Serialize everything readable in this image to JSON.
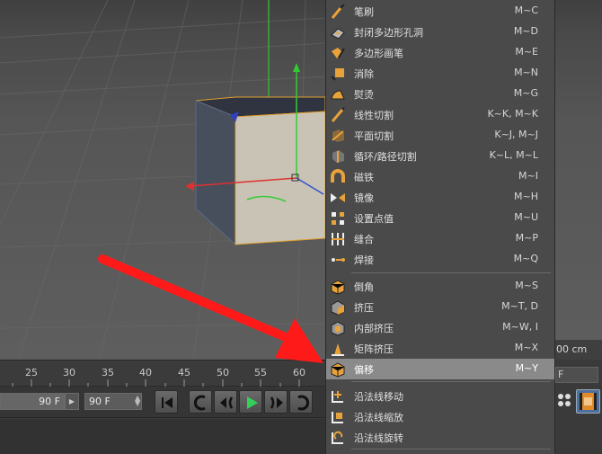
{
  "menu": {
    "items": [
      {
        "label": "笔刷",
        "shortcut": "M~C",
        "icon": "brush-icon"
      },
      {
        "label": "封闭多边形孔洞",
        "shortcut": "M~D",
        "icon": "close-hole-icon"
      },
      {
        "label": "多边形画笔",
        "shortcut": "M~E",
        "icon": "polygon-pen-icon"
      },
      {
        "label": "消除",
        "shortcut": "M~N",
        "icon": "dissolve-icon"
      },
      {
        "label": "熨烫",
        "shortcut": "M~G",
        "icon": "iron-icon"
      },
      {
        "label": "线性切割",
        "shortcut": "K~K, M~K",
        "icon": "line-cut-icon"
      },
      {
        "label": "平面切割",
        "shortcut": "K~J, M~J",
        "icon": "plane-cut-icon"
      },
      {
        "label": "循环/路径切割",
        "shortcut": "K~L, M~L",
        "icon": "loop-cut-icon"
      },
      {
        "label": "磁铁",
        "shortcut": "M~I",
        "icon": "magnet-icon"
      },
      {
        "label": "镜像",
        "shortcut": "M~H",
        "icon": "mirror-icon"
      },
      {
        "label": "设置点值",
        "shortcut": "M~U",
        "icon": "set-point-icon"
      },
      {
        "label": "缝合",
        "shortcut": "M~P",
        "icon": "stitch-icon"
      },
      {
        "label": "焊接",
        "shortcut": "M~Q",
        "icon": "weld-icon"
      },
      {
        "label": "倒角",
        "shortcut": "M~S",
        "icon": "bevel-icon"
      },
      {
        "label": "挤压",
        "shortcut": "M~T, D",
        "icon": "extrude-icon"
      },
      {
        "label": "内部挤压",
        "shortcut": "M~W, I",
        "icon": "extrude-inner-icon"
      },
      {
        "label": "矩阵挤压",
        "shortcut": "M~X",
        "icon": "matrix-extrude-icon"
      },
      {
        "label": "偏移",
        "shortcut": "M~Y",
        "icon": "offset-icon"
      },
      {
        "label": "沿法线移动",
        "shortcut": "",
        "icon": "normal-move-icon"
      },
      {
        "label": "沿法线缩放",
        "shortcut": "",
        "icon": "normal-scale-icon"
      },
      {
        "label": "沿法线旋转",
        "shortcut": "",
        "icon": "normal-rotate-icon"
      }
    ],
    "active_index": 17
  },
  "timeline": {
    "ticks": [
      "25",
      "30",
      "35",
      "40",
      "45",
      "50",
      "55",
      "60"
    ]
  },
  "transport": {
    "left_field": "90 F",
    "right_field": "90 F",
    "buttons": [
      "go-to-start-icon",
      "prev-key-icon",
      "prev-frame-icon",
      "play-icon",
      "next-frame-icon",
      "next-key-icon"
    ]
  },
  "viewport": {
    "units_readout": "00 cm"
  },
  "right_panel": {
    "field_text": "F"
  },
  "colors": {
    "menu_bg": "#4a4a4a",
    "menu_active": "#8a8a8a",
    "icon_orange": "#e8a23a",
    "arrow_red": "#ff1a1a",
    "axis_green": "#33cc33"
  }
}
